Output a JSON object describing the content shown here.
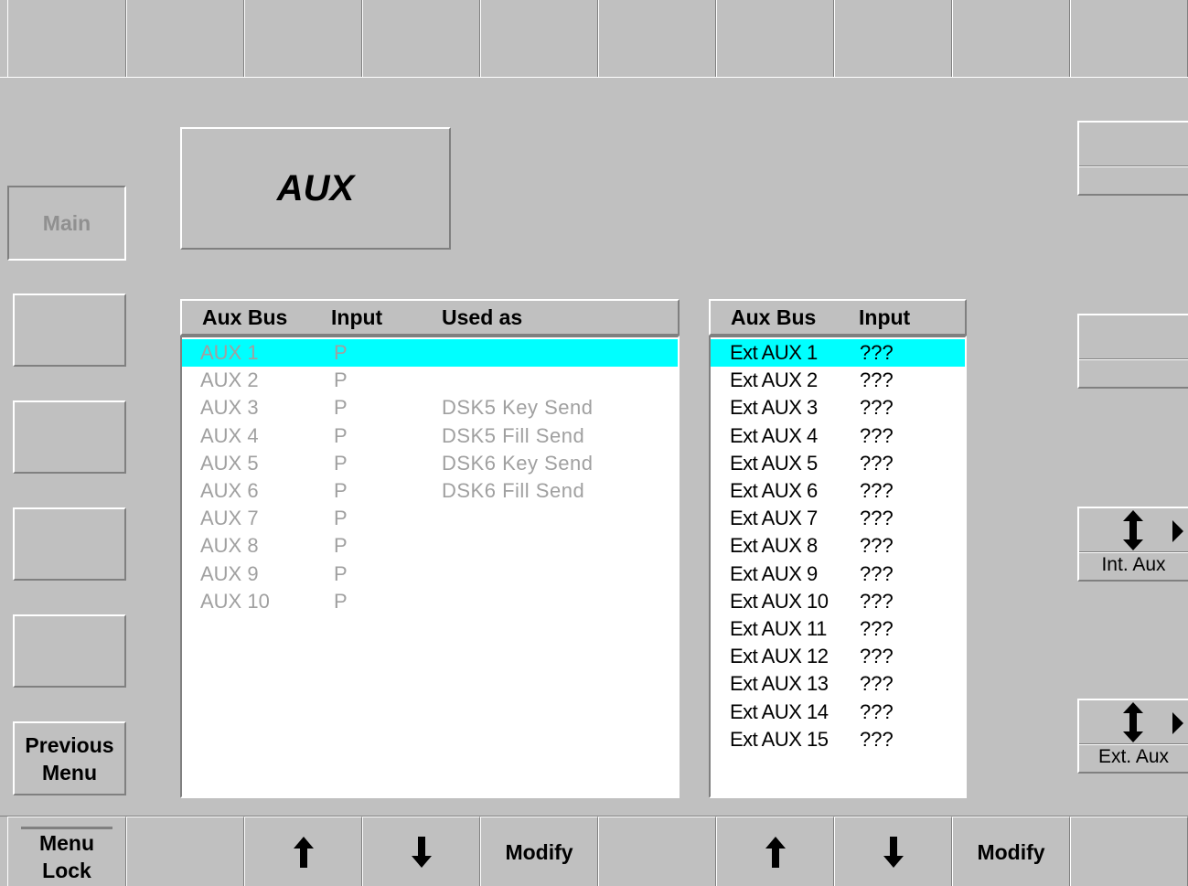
{
  "title": "AUX",
  "left_buttons": {
    "main": "Main",
    "previous_menu": "Previous\nMenu"
  },
  "int_list": {
    "headers": {
      "bus": "Aux Bus",
      "input": "Input",
      "used": "Used as"
    },
    "rows": [
      {
        "bus": "AUX 1",
        "input": "P",
        "used": ""
      },
      {
        "bus": "AUX 2",
        "input": "P",
        "used": ""
      },
      {
        "bus": "AUX 3",
        "input": "P",
        "used": "DSK5 Key Send"
      },
      {
        "bus": "AUX 4",
        "input": "P",
        "used": "DSK5 Fill Send"
      },
      {
        "bus": "AUX 5",
        "input": "P",
        "used": "DSK6 Key Send"
      },
      {
        "bus": "AUX 6",
        "input": "P",
        "used": "DSK6 Fill Send"
      },
      {
        "bus": "AUX 7",
        "input": "P",
        "used": ""
      },
      {
        "bus": "AUX 8",
        "input": "P",
        "used": ""
      },
      {
        "bus": "AUX 9",
        "input": "P",
        "used": ""
      },
      {
        "bus": "AUX 10",
        "input": "P",
        "used": ""
      }
    ],
    "selected_index": 0
  },
  "ext_list": {
    "headers": {
      "bus": "Aux Bus",
      "input": "Input"
    },
    "rows": [
      {
        "bus": "Ext AUX 1",
        "input": "???"
      },
      {
        "bus": "Ext AUX 2",
        "input": "???"
      },
      {
        "bus": "Ext AUX 3",
        "input": "???"
      },
      {
        "bus": "Ext AUX 4",
        "input": "???"
      },
      {
        "bus": "Ext AUX 5",
        "input": "???"
      },
      {
        "bus": "Ext AUX 6",
        "input": "???"
      },
      {
        "bus": "Ext AUX 7",
        "input": "???"
      },
      {
        "bus": "Ext AUX 8",
        "input": "???"
      },
      {
        "bus": "Ext AUX 9",
        "input": "???"
      },
      {
        "bus": "Ext AUX 10",
        "input": "???"
      },
      {
        "bus": "Ext AUX 11",
        "input": "???"
      },
      {
        "bus": "Ext AUX 12",
        "input": "???"
      },
      {
        "bus": "Ext AUX 13",
        "input": "???"
      },
      {
        "bus": "Ext AUX 14",
        "input": "???"
      },
      {
        "bus": "Ext AUX 15",
        "input": "???"
      }
    ],
    "selected_index": 0
  },
  "right_buttons": {
    "int_aux": "Int. Aux",
    "ext_aux": "Ext. Aux"
  },
  "bottom": {
    "menu_lock": "Menu\nLock",
    "up_arrow": "⬆",
    "down_arrow": "⬇",
    "modify": "Modify"
  },
  "colors": {
    "background": "#c0c0c0",
    "selection": "#00ffff",
    "disabled_text": "#a0a0a0"
  }
}
